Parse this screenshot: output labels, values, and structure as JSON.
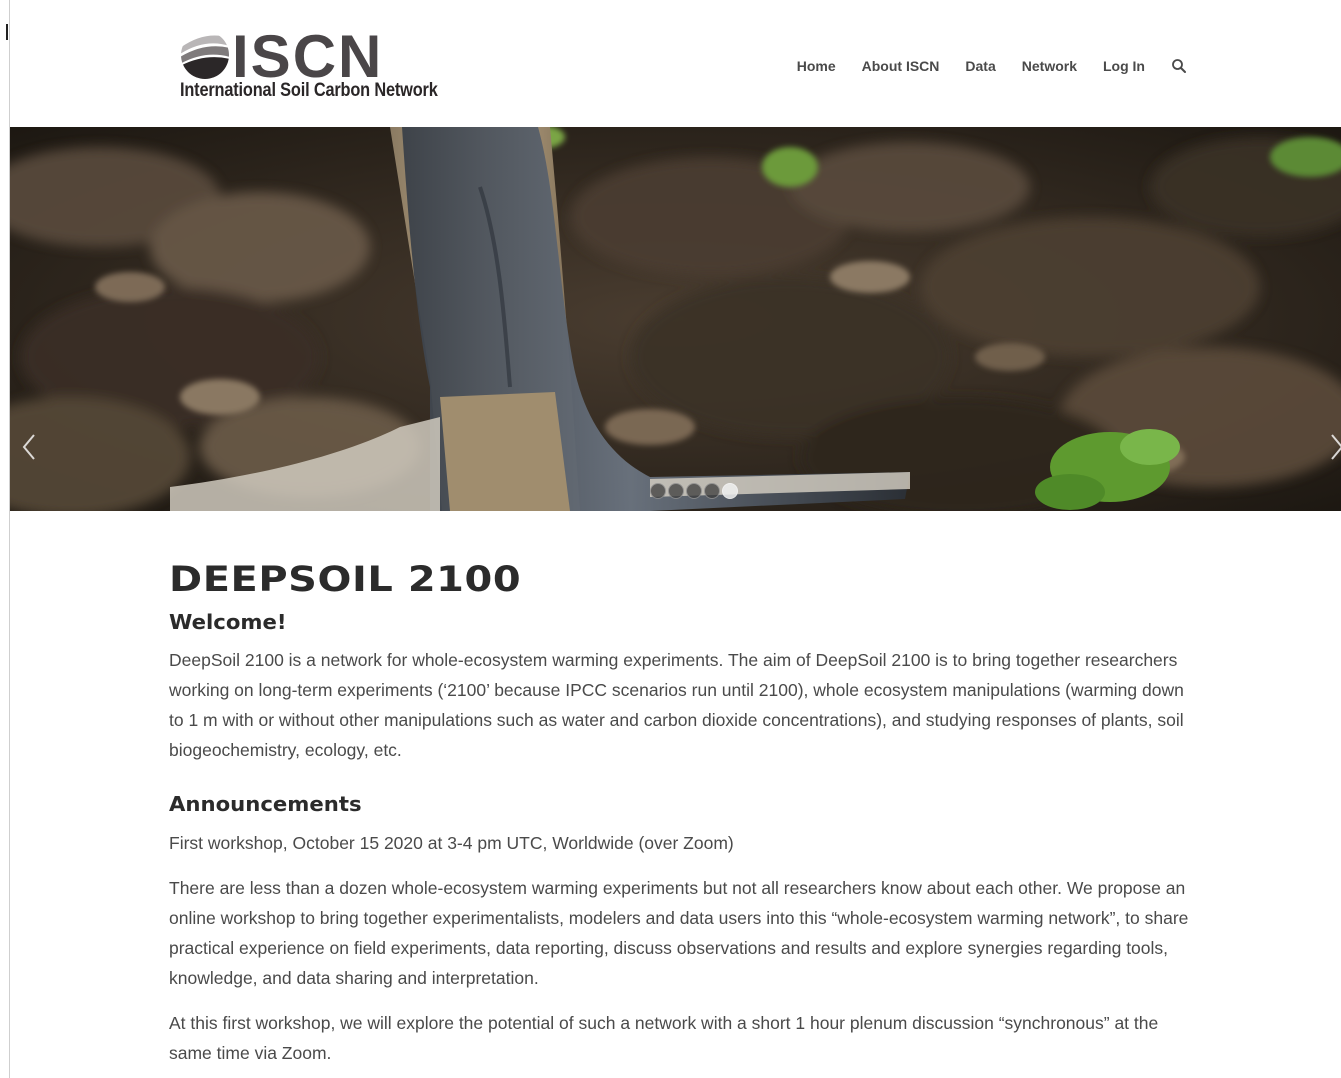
{
  "site": {
    "logo_word": "ISCN",
    "logo_subtitle": "International Soil Carbon Network",
    "brand_color": "#4a4648"
  },
  "nav": {
    "items": [
      {
        "label": "Home"
      },
      {
        "label": "About ISCN"
      },
      {
        "label": "Data"
      },
      {
        "label": "Network"
      },
      {
        "label": "Log In"
      }
    ],
    "search_icon": "search-icon"
  },
  "hero": {
    "slide_count": 5,
    "active_slide": 5,
    "prev_icon": "chevron-left-icon",
    "next_icon": "chevron-right-icon"
  },
  "main": {
    "title": "DEEPSOIL 2100",
    "welcome_heading": "Welcome!",
    "welcome_text": "DeepSoil 2100 is a network for whole-ecosystem warming experiments. The aim of DeepSoil 2100 is to bring together researchers working on long-term experiments (‘2100’ because IPCC scenarios run until 2100), whole ecosystem manipulations (warming down to 1 m with or without other manipulations such as water and carbon dioxide concentrations), and studying responses of plants, soil biogeochemistry, ecology, etc.",
    "announcements_heading": "Announcements",
    "paragraphs": [
      "First workshop, October 15 2020 at 3-4 pm UTC, Worldwide (over Zoom)",
      "There are less than a dozen whole-ecosystem warming experiments but not all researchers know about each other. We propose an online workshop to bring together experimentalists, modelers and data users into this “whole-ecosystem warming network”, to share practical experience on field experiments, data reporting, discuss observations and results and explore synergies regarding tools, knowledge, and data sharing and interpretation.",
      "At this first workshop, we will explore the potential of such a network with a short 1 hour plenum discussion “synchronous” at the same time via Zoom."
    ]
  }
}
